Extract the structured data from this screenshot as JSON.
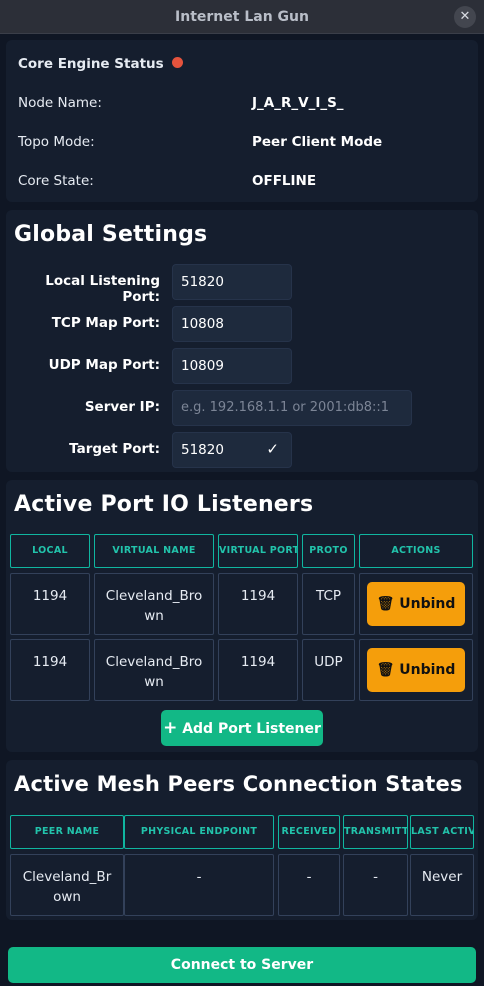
{
  "window": {
    "title": "Internet Lan Gun",
    "close_glyph": "✕"
  },
  "status": {
    "title": "Core Engine Status",
    "indicator_color": "#e5533d",
    "rows": [
      {
        "label": "Node Name:",
        "value": "J_A_R_V_I_S_"
      },
      {
        "label": "Topo Mode:",
        "value": "Peer Client Mode"
      },
      {
        "label": "Core State:",
        "value": "OFFLINE"
      }
    ]
  },
  "global_settings": {
    "heading": "Global Settings",
    "fields": [
      {
        "label": "Local Listening Port:",
        "value": "51820"
      },
      {
        "label": "TCP Map Port:",
        "value": "10808"
      },
      {
        "label": "UDP Map Port:",
        "value": "10809"
      },
      {
        "label": "Server IP:",
        "value": "",
        "placeholder": "e.g. 192.168.1.1 or 2001:db8::1"
      },
      {
        "label": "Target Port:",
        "value": "51820"
      }
    ]
  },
  "listeners": {
    "heading": "Active Port IO Listeners",
    "columns": [
      "LOCAL",
      "VIRTUAL NAME",
      "VIRTUAL PORT",
      "PROTO",
      "ACTIONS"
    ],
    "rows": [
      {
        "local": "1194",
        "virtual_name_1": "Cleveland_Bro",
        "virtual_name_2": "wn",
        "virtual_port": "1194",
        "proto": "TCP",
        "action": "Unbind"
      },
      {
        "local": "1194",
        "virtual_name_1": "Cleveland_Bro",
        "virtual_name_2": "wn",
        "virtual_port": "1194",
        "proto": "UDP",
        "action": "Unbind"
      }
    ],
    "add_button": "Add Port Listener",
    "accent_color": "#f59e0b"
  },
  "peers": {
    "heading": "Active Mesh Peers Connection States",
    "columns": [
      "PEER NAME",
      "PHYSICAL ENDPOINT",
      "RECEIVED",
      "TRANSMITTED",
      "LAST ACTIVE"
    ],
    "rows": [
      {
        "peer_name_1": "Cleveland_Br",
        "peer_name_2": "own",
        "endpoint": "-",
        "received": "-",
        "transmitted": "-",
        "last_active": "Never"
      }
    ]
  },
  "footer": {
    "connect_button": "Connect to Server",
    "brand_color": "#12b886"
  }
}
